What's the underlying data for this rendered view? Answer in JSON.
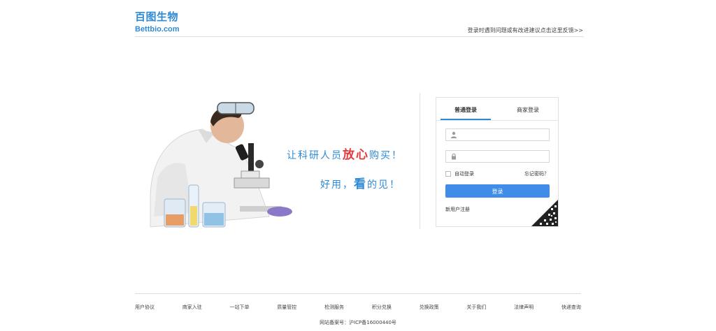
{
  "header": {
    "logo_cn": "百图生物",
    "logo_en": "Bettbio.com",
    "feedback_link": "登录时遇到问题或有改进建议点击这里反馈>>"
  },
  "banner": {
    "slogan1_prefix": "让科研人员",
    "slogan1_highlight": "放心",
    "slogan1_suffix": "购买！",
    "slogan2_prefix": "好用，",
    "slogan2_highlight": "看",
    "slogan2_suffix": "的见！"
  },
  "login": {
    "tabs": [
      {
        "label": "普通登录",
        "active": true
      },
      {
        "label": "商家登录",
        "active": false
      }
    ],
    "username_placeholder": "",
    "password_placeholder": "",
    "remember_label": "自动登录",
    "forgot_label": "忘记密码？",
    "submit_label": "登录",
    "register_label": "新用户注册"
  },
  "footer": {
    "links": [
      "用户协议",
      "商家入驻",
      "一站下单",
      "质量管控",
      "检测服务",
      "积分兑换",
      "兑换政策",
      "关于我们",
      "法律声明",
      "快递查询"
    ],
    "icp": "网站备案号：沪ICP备16000440号"
  },
  "colors": {
    "brand_blue": "#2f8ad6",
    "button_blue": "#3f8ce9",
    "highlight_red": "#e23c3c"
  }
}
